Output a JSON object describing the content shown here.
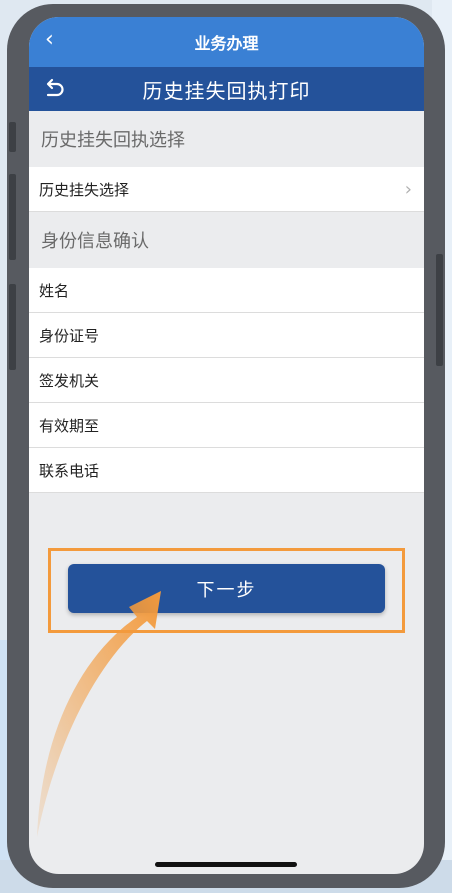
{
  "status_bar": {
    "title": "业务办理",
    "back_icon": "chevron-left-icon"
  },
  "nav_bar": {
    "title": "历史挂失回执打印",
    "undo_icon": "undo-arrow-icon"
  },
  "section_receipt": {
    "heading": "历史挂失回执选择",
    "items": [
      {
        "label": "历史挂失选择",
        "chevron": "›"
      }
    ]
  },
  "section_identity": {
    "heading": "身份信息确认",
    "fields": [
      {
        "label": "姓名"
      },
      {
        "label": "身份证号"
      },
      {
        "label": "签发机关"
      },
      {
        "label": "有效期至"
      },
      {
        "label": "联系电话"
      }
    ]
  },
  "actions": {
    "next_label": "下一步"
  },
  "colors": {
    "status_bar": "#3a80d4",
    "nav_bar": "#24529a",
    "primary_button": "#24529a",
    "highlight": "#f39a3c"
  }
}
